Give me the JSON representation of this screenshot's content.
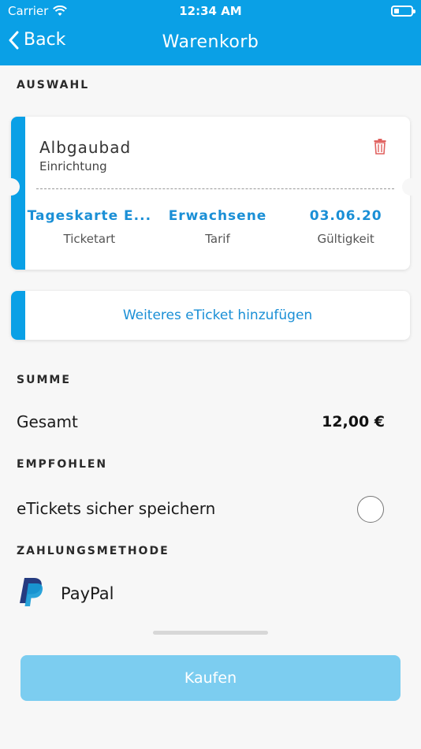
{
  "status_bar": {
    "carrier": "Carrier",
    "time": "12:34 AM"
  },
  "nav": {
    "back_label": "Back",
    "title": "Warenkorb"
  },
  "sections": {
    "selection": "AUSWAHL",
    "sum": "SUMME",
    "recommended": "EMPFOHLEN",
    "payment": "ZAHLUNGSMETHODE"
  },
  "ticket": {
    "name": "Albgaubad",
    "type": "Einrichtung",
    "fields": [
      {
        "value": "Tageskarte E...",
        "label": "Ticketart"
      },
      {
        "value": "Erwachsene",
        "label": "Tarif"
      },
      {
        "value": "03.06.20",
        "label": "Gültigkeit"
      }
    ]
  },
  "add_ticket_label": "Weiteres eTicket hinzufügen",
  "total": {
    "label": "Gesamt",
    "value": "12,00 €"
  },
  "recommended": {
    "label": "eTickets sicher speichern",
    "checked": false
  },
  "payment": {
    "label": "PayPal",
    "icon": "paypal-icon"
  },
  "buy_label": "Kaufen",
  "colors": {
    "accent": "#0aa0e6",
    "link": "#1a8fd6",
    "button_disabled": "#7ccdf0",
    "delete": "#e0605e"
  }
}
